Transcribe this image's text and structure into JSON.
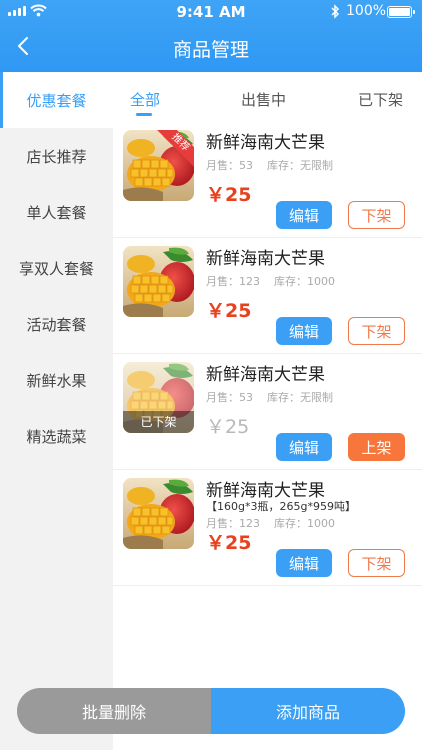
{
  "status_bar": {
    "time": "9:41 AM",
    "battery": "100%"
  },
  "nav": {
    "title": "商品管理"
  },
  "sidebar": {
    "items": [
      {
        "label": "优惠套餐"
      },
      {
        "label": "店长推荐"
      },
      {
        "label": "单人套餐"
      },
      {
        "label": "享双人套餐"
      },
      {
        "label": "活动套餐"
      },
      {
        "label": "新鲜水果"
      },
      {
        "label": "精选蔬菜"
      }
    ]
  },
  "tabs": [
    {
      "label": "全部"
    },
    {
      "label": "出售中"
    },
    {
      "label": "已下架"
    }
  ],
  "products": [
    {
      "name": "新鲜海南大芒果",
      "sales": "月售：53",
      "stock": "库存：无限制",
      "price": "￥25",
      "ribbon": "推荐",
      "edit": "编辑",
      "action": "下架"
    },
    {
      "name": "新鲜海南大芒果",
      "sales": "月售：123",
      "stock": "库存：1000",
      "price": "￥25",
      "edit": "编辑",
      "action": "下架"
    },
    {
      "name": "新鲜海南大芒果",
      "sales": "月售：53",
      "stock": "库存：无限制",
      "price": "￥25",
      "overlay": "已下架",
      "edit": "编辑",
      "action": "上架"
    },
    {
      "name": "新鲜海南大芒果",
      "spec": "【160g*3瓶，265g*959吨】",
      "sales": "月售：123",
      "stock": "库存：1000",
      "price": "￥25",
      "edit": "编辑",
      "action": "下架"
    }
  ],
  "bottom_bar": {
    "delete_label": "批量删除",
    "add_label": "添加商品"
  },
  "colors": {
    "primary": "#3a9ff5",
    "price": "#e8411e",
    "delist": "#f07a4a",
    "ribbon": "#e63c3c"
  }
}
